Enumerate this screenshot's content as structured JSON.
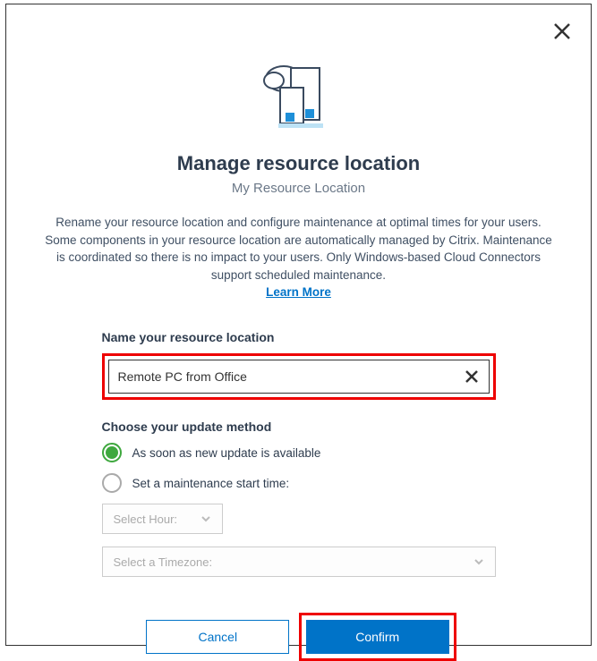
{
  "dialog": {
    "title": "Manage resource location",
    "subtitle": "My Resource Location",
    "description": "Rename your resource location and configure maintenance at optimal times for your users. Some components in your resource location are automatically managed by Citrix. Maintenance is coordinated so there is no impact to your users. Only Windows-based Cloud Connectors support scheduled maintenance.",
    "learn_more": "Learn More"
  },
  "form": {
    "name_label": "Name your resource location",
    "name_value": "Remote PC from Office",
    "update_label": "Choose your update method",
    "radio_options": [
      {
        "label": "As soon as new update is available",
        "selected": true
      },
      {
        "label": "Set a maintenance start time:",
        "selected": false
      }
    ],
    "select_hour_placeholder": "Select Hour:",
    "select_tz_placeholder": "Select a Timezone:"
  },
  "buttons": {
    "cancel": "Cancel",
    "confirm": "Confirm"
  },
  "colors": {
    "accent": "#0073c8",
    "highlight": "#ee0000",
    "radio_selected": "#3fa83f"
  }
}
